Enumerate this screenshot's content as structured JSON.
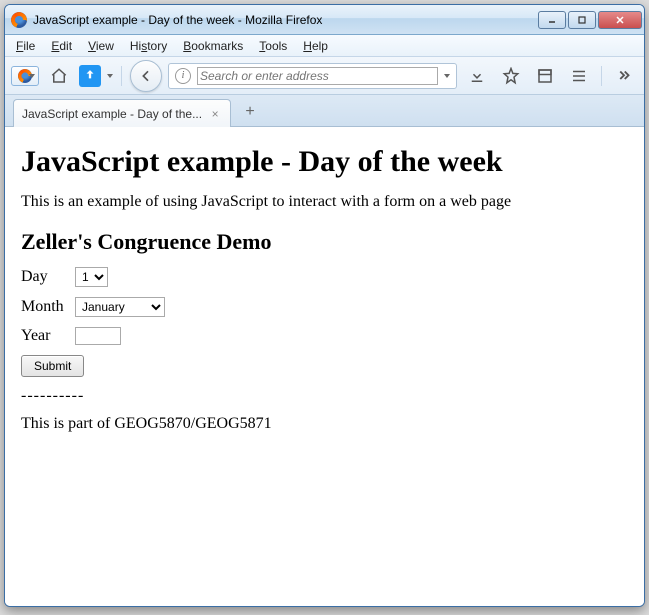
{
  "window": {
    "title": "JavaScript example - Day of the week - Mozilla Firefox"
  },
  "menubar": [
    "File",
    "Edit",
    "View",
    "History",
    "Bookmarks",
    "Tools",
    "Help"
  ],
  "toolbar": {
    "address_placeholder": "Search or enter address"
  },
  "tab": {
    "label": "JavaScript example - Day of the..."
  },
  "page": {
    "h1": "JavaScript example - Day of the week",
    "intro": "This is an example of using JavaScript to interact with a form on a web page",
    "h2": "Zeller's Congruence Demo",
    "form": {
      "day_label": "Day",
      "day_value": "1",
      "month_label": "Month",
      "month_value": "January",
      "year_label": "Year",
      "year_value": "",
      "submit_label": "Submit"
    },
    "separator": "----------",
    "footer": "This is part of GEOG5870/GEOG5871"
  }
}
